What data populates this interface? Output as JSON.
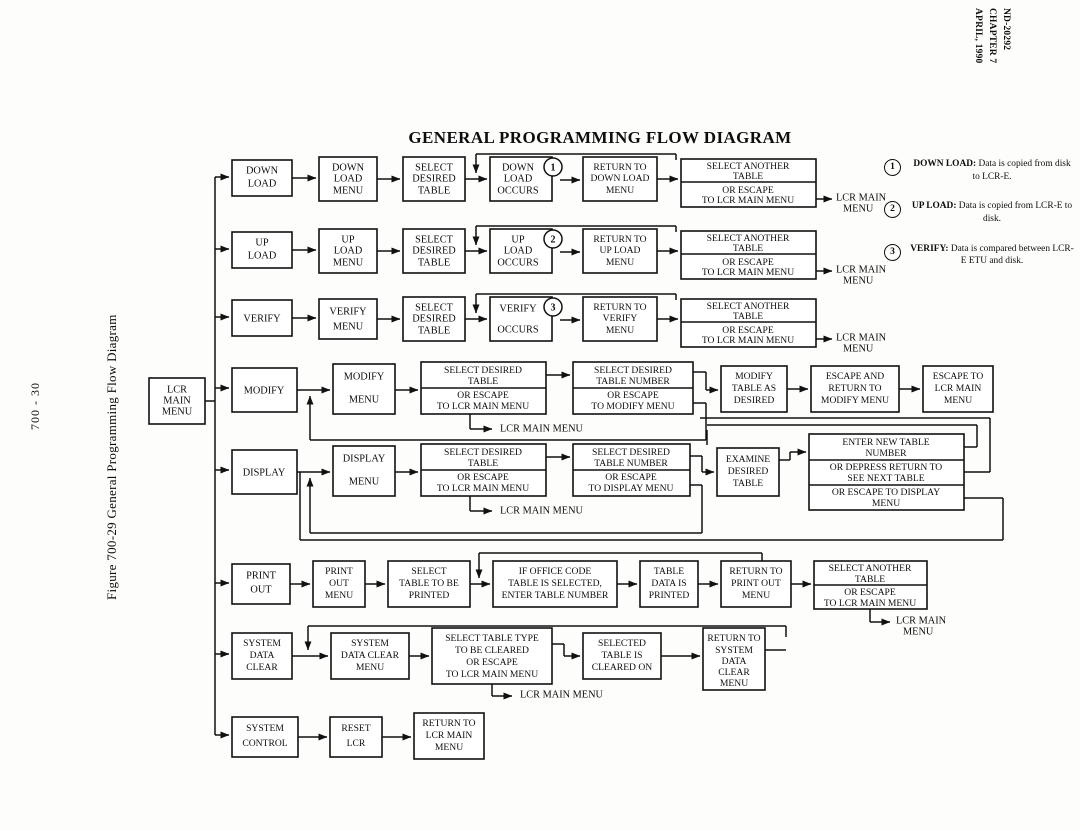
{
  "document": {
    "header_lines": [
      "ND-20292",
      "CHAPTER 7",
      "APRIL, 1990"
    ],
    "figure_caption": "Figure 700-29   General Programming Flow Diagram",
    "page_number": "700 - 30",
    "diagram_title": "GENERAL PROGRAMMING FLOW DIAGRAM"
  },
  "root": {
    "label": "LCR\nMAIN\nMENU"
  },
  "rows": [
    {
      "name": "down-load",
      "boxes": [
        {
          "id": "down-load",
          "text": "DOWN\nLOAD"
        },
        {
          "id": "down-load-menu",
          "text": "DOWN\nLOAD\nMENU"
        },
        {
          "id": "select-desired-table",
          "text": "SELECT\nDESIRED\nTABLE"
        },
        {
          "id": "down-load-occurs",
          "text": "DOWN\nLOAD\nOCCURS",
          "marker": "1"
        },
        {
          "id": "return-to-down-load-menu",
          "text": "RETURN TO\nDOWN LOAD\nMENU"
        },
        {
          "id": "select-another-table",
          "text_top": "SELECT ANOTHER\nTABLE",
          "text_bottom": "OR ESCAPE\nTO LCR MAIN MENU"
        }
      ],
      "exit_label": "LCR MAIN\nMENU"
    },
    {
      "name": "up-load",
      "boxes": [
        {
          "id": "up-load",
          "text": "UP\nLOAD"
        },
        {
          "id": "up-load-menu",
          "text": "UP\nLOAD\nMENU"
        },
        {
          "id": "select-desired-table",
          "text": "SELECT\nDESIRED\nTABLE"
        },
        {
          "id": "up-load-occurs",
          "text": "UP\nLOAD\nOCCURS",
          "marker": "2"
        },
        {
          "id": "return-to-up-load-menu",
          "text": "RETURN TO\nUP LOAD\nMENU"
        },
        {
          "id": "select-another-table",
          "text_top": "SELECT ANOTHER\nTABLE",
          "text_bottom": "OR ESCAPE\nTO LCR MAIN MENU"
        }
      ],
      "exit_label": "LCR MAIN\nMENU"
    },
    {
      "name": "verify",
      "boxes": [
        {
          "id": "verify",
          "text": "VERIFY"
        },
        {
          "id": "verify-menu",
          "text": "VERIFY\nMENU"
        },
        {
          "id": "select-desired-table",
          "text": "SELECT\nDESIRED\nTABLE"
        },
        {
          "id": "verify-occurs",
          "text": "VERIFY\n\nOCCURS",
          "marker": "3"
        },
        {
          "id": "return-to-verify-menu",
          "text": "RETURN TO\nVERIFY\nMENU"
        },
        {
          "id": "select-another-table",
          "text_top": "SELECT ANOTHER\nTABLE",
          "text_bottom": "OR ESCAPE\nTO LCR MAIN MENU"
        }
      ],
      "exit_label": "LCR MAIN\nMENU"
    },
    {
      "name": "modify",
      "boxes": [
        {
          "id": "modify",
          "text": "MODIFY"
        },
        {
          "id": "modify-menu",
          "text": "MODIFY\n\nMENU"
        },
        {
          "id": "select-desired-table",
          "text_top": "SELECT DESIRED\nTABLE",
          "text_bottom": "OR ESCAPE\nTO LCR MAIN MENU"
        },
        {
          "id": "select-desired-table-number",
          "text_top": "SELECT  DESIRED\nTABLE  NUMBER",
          "text_bottom": "OR ESCAPE\nTO MODIFY MENU"
        },
        {
          "id": "modify-table-as-desired",
          "text": "MODIFY\nTABLE AS\nDESIRED"
        },
        {
          "id": "escape-and-return-to-modify-menu",
          "text": "ESCAPE AND\nRETURN TO\nMODIFY MENU"
        },
        {
          "id": "escape-to-lcr-main-menu",
          "text": "ESCAPE TO\nLCR MAIN\nMENU"
        }
      ],
      "escape_label": "LCR MAIN MENU"
    },
    {
      "name": "display",
      "boxes": [
        {
          "id": "display",
          "text": "DISPLAY"
        },
        {
          "id": "display-menu",
          "text": "DISPLAY\n\nMENU"
        },
        {
          "id": "select-desired-table",
          "text_top": "SELECT DESIRED\nTABLE",
          "text_bottom": "OR ESCAPE\nTO LCR MAIN MENU"
        },
        {
          "id": "select-desired-table-number",
          "text_top": "SELECT DESIRED\nTABLE  NUMBER",
          "text_bottom": "OR ESCAPE\nTO DISPLAY MENU"
        },
        {
          "id": "examine-desired-table",
          "text": "EXAMINE\nDESIRED\nTABLE"
        },
        {
          "id": "enter-new-table-number",
          "text_top": "ENTER NEW TABLE\nNUMBER",
          "text_mid": "OR DEPRESS RETURN TO\nSEE NEXT TABLE",
          "text_bottom": "OR ESCAPE TO DISPLAY\nMENU"
        }
      ],
      "escape_label": "LCR MAIN MENU"
    },
    {
      "name": "print-out",
      "boxes": [
        {
          "id": "print-out",
          "text": "PRINT\nOUT"
        },
        {
          "id": "print-out-menu",
          "text": "PRINT\nOUT\nMENU"
        },
        {
          "id": "select-table-to-be-printed",
          "text": "SELECT\nTABLE TO BE\nPRINTED"
        },
        {
          "id": "if-office-code-table",
          "text": "IF OFFICE CODE\nTABLE IS SELECTED,\nENTER TABLE NUMBER"
        },
        {
          "id": "table-data-is-printed",
          "text": "TABLE\nDATA IS\nPRINTED"
        },
        {
          "id": "return-to-print-out-menu",
          "text": "RETURN TO\nPRINT OUT\nMENU"
        },
        {
          "id": "select-another-table",
          "text_top": "SELECT ANOTHER\nTABLE",
          "text_bottom": "OR ESCAPE\nTO LCR MAIN MENU"
        }
      ],
      "escape_label": "LCR MAIN\nMENU"
    },
    {
      "name": "system-data-clear",
      "boxes": [
        {
          "id": "system-data-clear",
          "text": "SYSTEM\nDATA\nCLEAR"
        },
        {
          "id": "system-data-clear-menu",
          "text": "SYSTEM\nDATA CLEAR\nMENU"
        },
        {
          "id": "select-table-type",
          "text": "SELECT  TABLE TYPE\nTO BE CLEARED\nOR ESCAPE\nTO LCR MAIN MENU"
        },
        {
          "id": "selected-table-is-cleared-on",
          "text": "SELECTED\nTABLE IS\nCLEARED ON"
        },
        {
          "id": "return-to-system-data-clear-menu",
          "text": "RETURN TO\nSYSTEM\nDATA\nCLEAR\nMENU"
        }
      ],
      "escape_label": "LCR MAIN MENU"
    },
    {
      "name": "system-control",
      "boxes": [
        {
          "id": "system-control",
          "text": "SYSTEM\nCONTROL"
        },
        {
          "id": "reset-lcr",
          "text": "RESET\nLCR"
        },
        {
          "id": "return-to-lcr-main-menu",
          "text": "RETURN TO\nLCR MAIN\nMENU"
        }
      ]
    }
  ],
  "legend": [
    {
      "num": "1",
      "title": "DOWN LOAD:",
      "body": "Data is copied from disk to LCR-E."
    },
    {
      "num": "2",
      "title": "UP LOAD:",
      "body": "Data is copied from LCR-E to disk."
    },
    {
      "num": "3",
      "title": "VERIFY:",
      "body": "Data is compared between LCR-E ETU and disk."
    }
  ]
}
